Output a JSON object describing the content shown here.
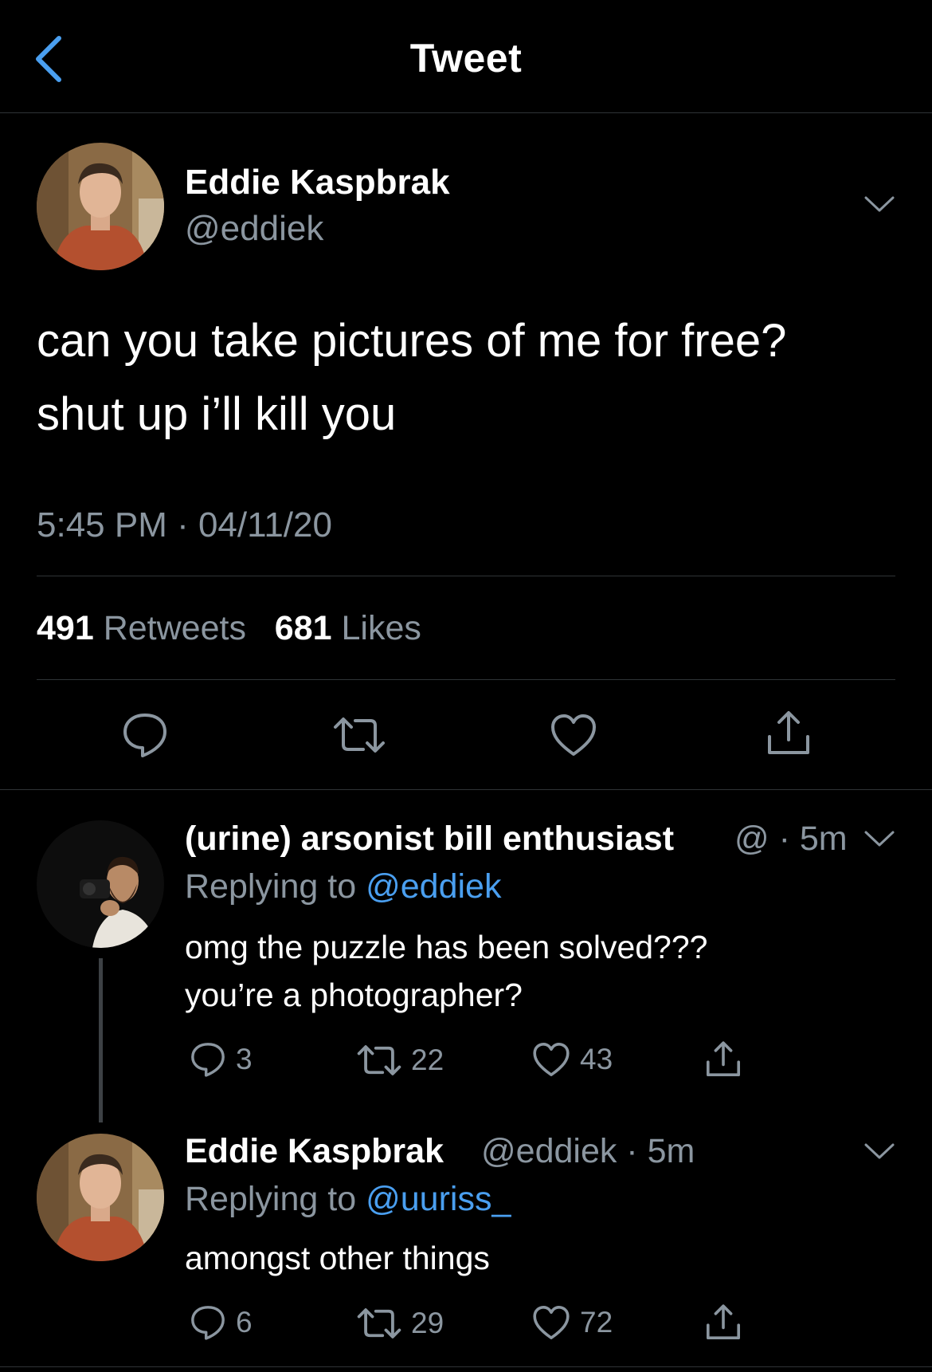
{
  "header": {
    "title": "Tweet"
  },
  "main_tweet": {
    "author_name": "Eddie Kaspbrak",
    "author_handle": "@eddiek",
    "text_line1": "can you take pictures of me for free?",
    "text_line2": "shut up i’ll kill you",
    "timestamp": "5:45 PM · 04/11/20",
    "retweets_count": "491",
    "retweets_label": "Retweets",
    "likes_count": "681",
    "likes_label": "Likes"
  },
  "replies": [
    {
      "author_name": "(urine) arsonist bill enthusiast",
      "meta": "@ · 5m",
      "replying_prefix": "Replying to",
      "replying_handle": "@eddiek",
      "text_line1": "omg the puzzle has been solved???",
      "text_line2": "you’re a photographer?",
      "reply_count": "3",
      "retweet_count": "22",
      "like_count": "43"
    },
    {
      "author_name": "Eddie Kaspbrak",
      "meta": "@eddiek · 5m",
      "replying_prefix": "Replying to",
      "replying_handle": "@uuriss_",
      "text_line1": "amongst other things",
      "reply_count": "6",
      "retweet_count": "29",
      "like_count": "72"
    }
  ],
  "icons": {
    "back": "chevron-left-icon",
    "more": "chevron-down-icon",
    "reply": "speech-bubble-icon",
    "retweet": "retweet-arrows-icon",
    "like": "heart-outline-icon",
    "share": "share-upload-icon"
  },
  "colors": {
    "background": "#000000",
    "text": "#ffffff",
    "secondary": "#8b96a0",
    "accent": "#4a9ff0",
    "divider": "#2f3336"
  }
}
